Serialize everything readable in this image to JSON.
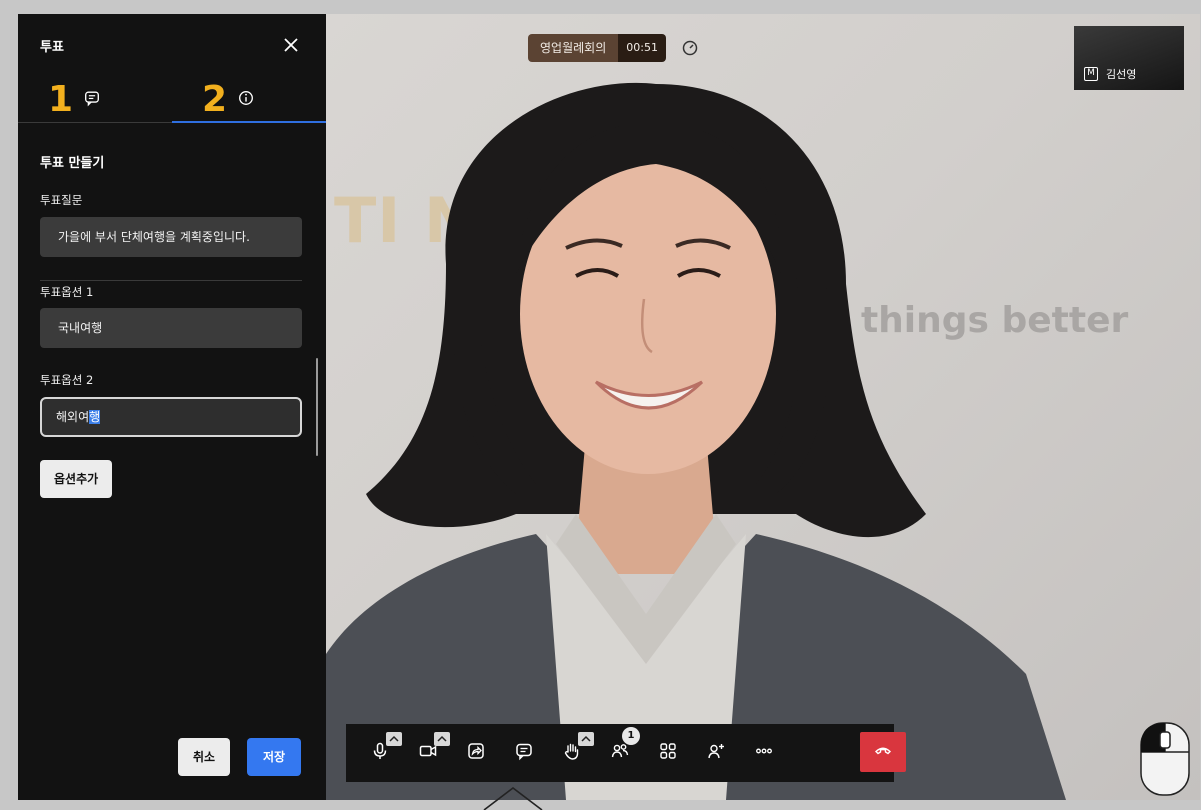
{
  "meeting": {
    "title": "영업월례회의",
    "elapsed": "00:51"
  },
  "self_view": {
    "badge": "M",
    "name": "김선영"
  },
  "background_text": {
    "line1": "TI           N GROUP",
    "line2": "e things better"
  },
  "panel": {
    "title": "투표",
    "tabs": [
      {
        "number": "1",
        "icon": "chat-icon"
      },
      {
        "number": "2",
        "icon": "info-icon"
      }
    ],
    "heading": "투표 만들기",
    "question_label": "투표질문",
    "question_value": "가을에 부서 단체여행을 계획중입니다.",
    "option1_label": "투표옵션 1",
    "option1_value": "국내여행",
    "option2_label": "투표옵션 2",
    "option2_value_prefix": "해외여",
    "option2_value_caret": "행",
    "add_option": "옵션추가",
    "cancel": "취소",
    "save": "저장"
  },
  "toolbar": {
    "items": [
      "microphone-icon",
      "camera-icon",
      "share-screen-icon",
      "chat-icon",
      "raise-hand-icon",
      "participants-icon",
      "grid-view-icon",
      "invite-icon",
      "more-icon",
      "end-call-icon"
    ],
    "participants_badge": "1"
  },
  "colors": {
    "panel_bg": "#121212",
    "accent_blue": "#3478f0",
    "tab_number": "#f2b01e",
    "end_call": "#d9363e"
  }
}
